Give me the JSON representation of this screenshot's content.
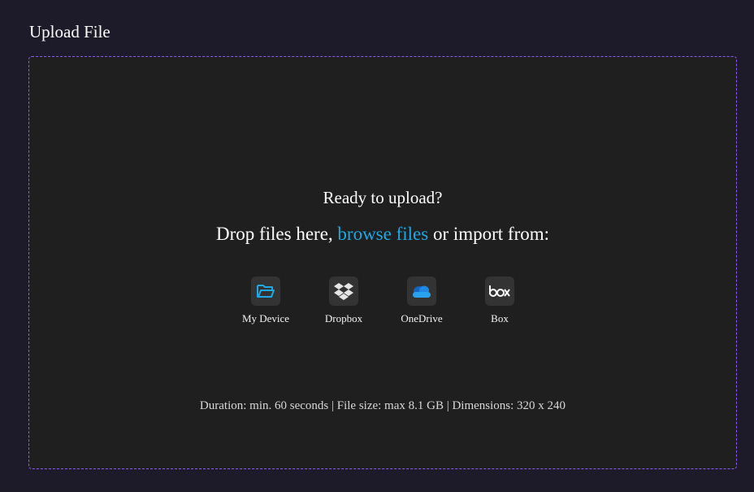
{
  "panel": {
    "title": "Upload File"
  },
  "dropzone": {
    "heading": "Ready to upload?",
    "drop_prefix": "Drop files here, ",
    "browse_label": "browse files",
    "drop_suffix": " or import from:",
    "sources": [
      {
        "label": "My Device",
        "icon": "folder-open-icon"
      },
      {
        "label": "Dropbox",
        "icon": "dropbox-icon"
      },
      {
        "label": "OneDrive",
        "icon": "onedrive-icon"
      },
      {
        "label": "Box",
        "icon": "box-icon"
      }
    ],
    "requirements": "Duration: min. 60 seconds | File size: max 8.1 GB | Dimensions: 320 x 240"
  },
  "colors": {
    "accent": "#1ca9e6",
    "dropzone_border": "#8b5cf6",
    "background": "#1e1b28",
    "dropzone_bg": "#1f1f1f",
    "onedrive": "#1e88e5"
  }
}
